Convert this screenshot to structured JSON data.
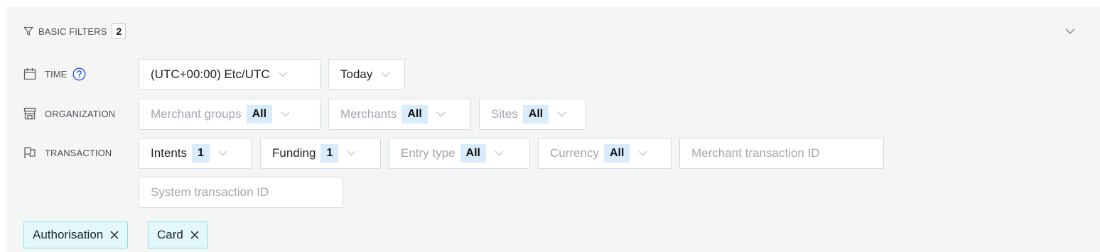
{
  "header": {
    "title": "BASIC FILTERS",
    "count": "2"
  },
  "rows": {
    "time": {
      "label": "TIME"
    },
    "organization": {
      "label": "ORGANIZATION"
    },
    "transaction": {
      "label": "TRANSACTION"
    }
  },
  "time": {
    "timezone": "(UTC+00:00) Etc/UTC",
    "range": "Today"
  },
  "organization": {
    "merchant_groups": {
      "label": "Merchant groups",
      "value": "All"
    },
    "merchants": {
      "label": "Merchants",
      "value": "All"
    },
    "sites": {
      "label": "Sites",
      "value": "All"
    }
  },
  "transaction": {
    "intents": {
      "label": "Intents",
      "value": "1"
    },
    "funding": {
      "label": "Funding",
      "value": "1"
    },
    "entry_type": {
      "label": "Entry type",
      "value": "All"
    },
    "currency": {
      "label": "Currency",
      "value": "All"
    },
    "merchant_transaction_id": {
      "placeholder": "Merchant transaction ID",
      "value": ""
    },
    "system_transaction_id": {
      "placeholder": "System transaction ID",
      "value": ""
    }
  },
  "chips": [
    {
      "label": "Authorisation"
    },
    {
      "label": "Card"
    }
  ],
  "icons": {
    "header": "filter-icon",
    "collapse": "chevron-down-icon",
    "time": "calendar-icon",
    "help": "help-circle-icon",
    "organization": "store-icon",
    "transaction": "flag-icon",
    "chip_remove": "close-icon"
  },
  "colors": {
    "panel_bg": "#f4f6f6",
    "badge_bg": "#d9ecfb",
    "chip_bg": "#e3f8fb",
    "chip_border": "#8fdde7",
    "help_blue": "#2f54eb"
  }
}
